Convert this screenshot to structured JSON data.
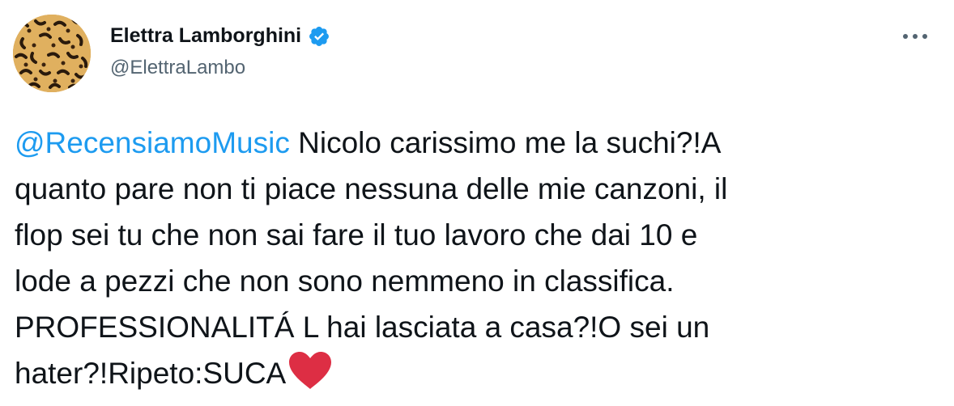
{
  "author": {
    "display_name": "Elettra Lamborghini",
    "handle": "@ElettraLambo",
    "verified": true,
    "avatar_icon": "leopard-print-avatar"
  },
  "more_icon": "more-horizontal-icon",
  "tweet": {
    "mention": "@RecensiamoMusic",
    "lines": [
      " Nicolo carissimo me la suchi?!A",
      "quanto pare non ti piace nessuna delle mie canzoni, il",
      "flop sei tu che non sai fare il tuo lavoro che dai 10 e",
      "lode a pezzi che non sono nemmeno in classifica.",
      "PROFESSIONALITÁ L hai lasciata a casa?!O sei un",
      "hater?!Ripeto:SUCA"
    ],
    "emoji_icon": "red-heart-icon"
  },
  "colors": {
    "link": "#1d9bf0",
    "text": "#0f1419",
    "secondary": "#536471",
    "verified_badge": "#1d9bf0",
    "heart": "#dd2e44"
  }
}
